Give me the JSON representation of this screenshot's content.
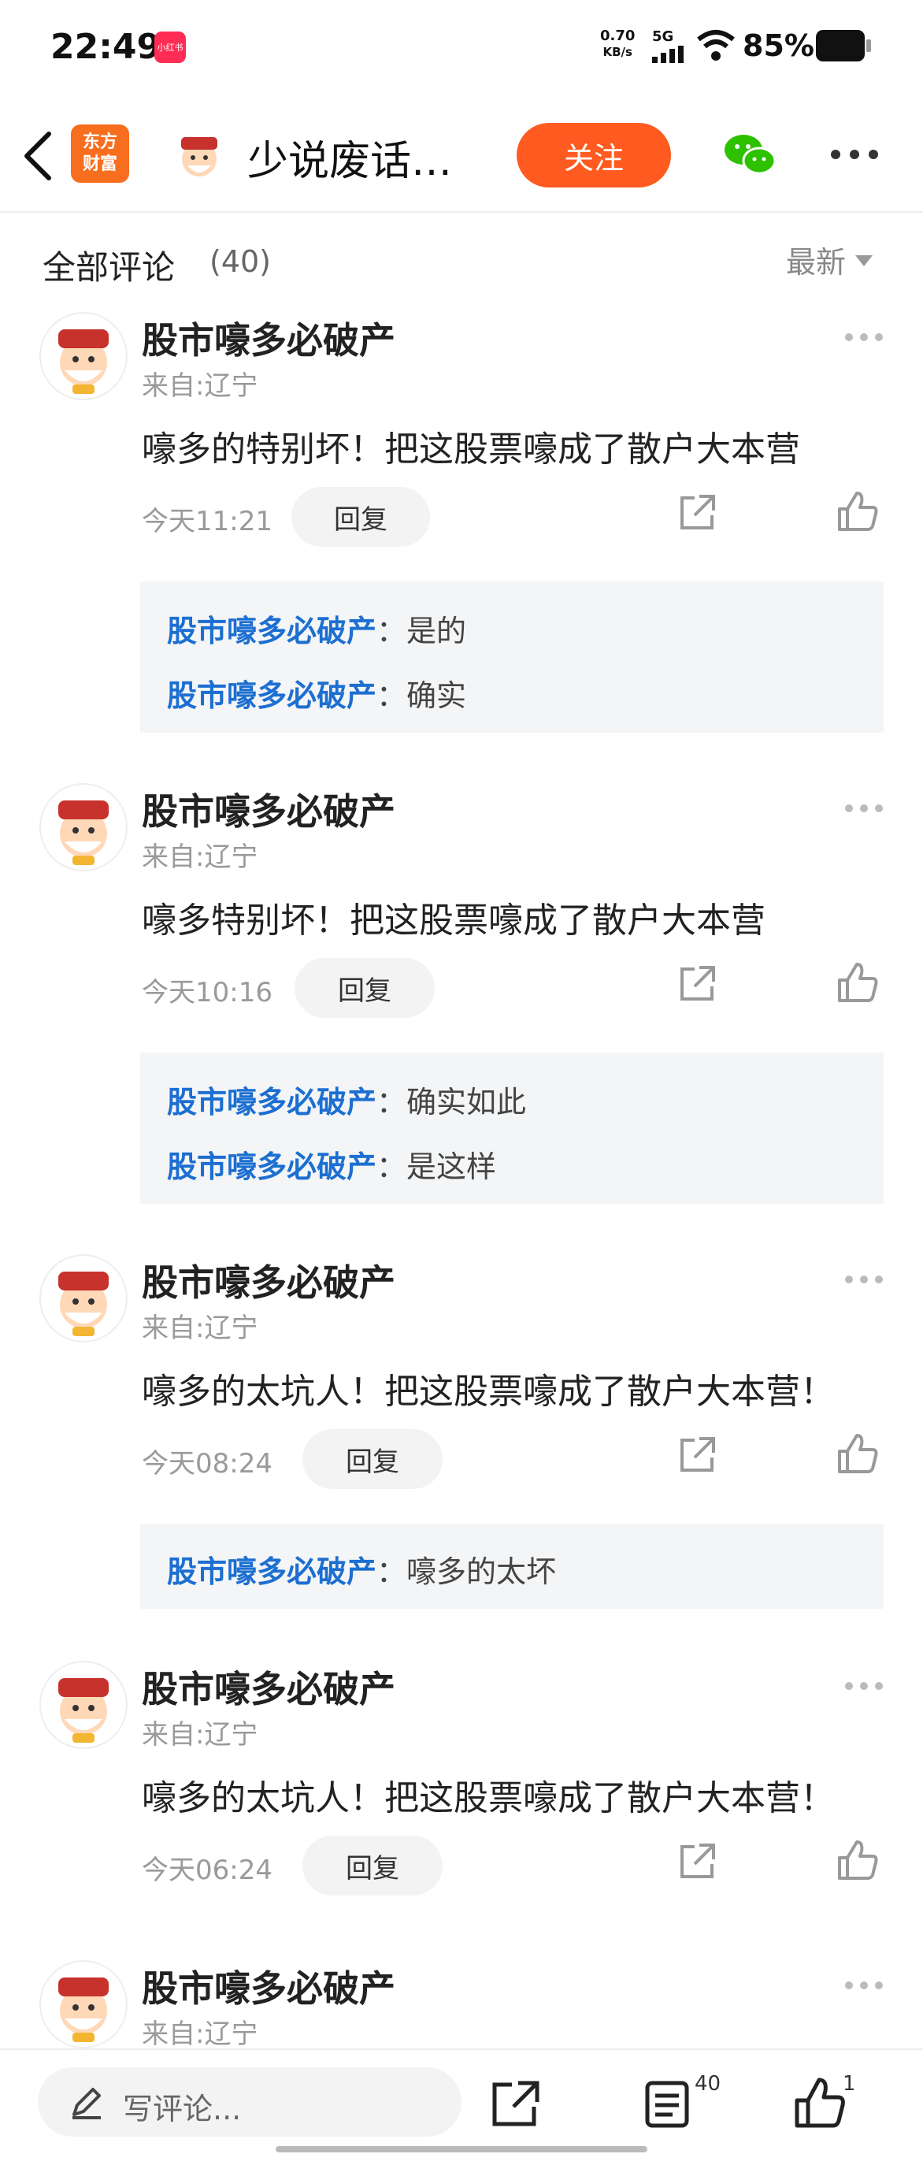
{
  "status_bar": {
    "time": "22:49",
    "app_badge": "小红书",
    "net_speed_value": "0.70",
    "net_speed_unit": "KB/s",
    "network": "5G",
    "battery": "85%"
  },
  "header": {
    "logo_line1": "东方",
    "logo_line2": "财富",
    "title": "少说废话…",
    "follow_label": "关注"
  },
  "section": {
    "title": "全部评论",
    "count": "(40)",
    "sort_label": "最新"
  },
  "comments": [
    {
      "user": "股市嚎多必破产",
      "location": "来自:辽宁",
      "text": "嚎多的特别坏！把这股票嚎成了散户大本营",
      "time": "今天11:21",
      "reply_label": "回复",
      "replies": [
        {
          "user": "股市嚎多必破产",
          "text": "：是的"
        },
        {
          "user": "股市嚎多必破产",
          "text": "：确实"
        }
      ]
    },
    {
      "user": "股市嚎多必破产",
      "location": "来自:辽宁",
      "text": "嚎多特别坏！把这股票嚎成了散户大本营",
      "time": "今天10:16",
      "reply_label": "回复",
      "replies": [
        {
          "user": "股市嚎多必破产",
          "text": "：确实如此"
        },
        {
          "user": "股市嚎多必破产",
          "text": "：是这样"
        }
      ]
    },
    {
      "user": "股市嚎多必破产",
      "location": "来自:辽宁",
      "text": "嚎多的太坑人！把这股票嚎成了散户大本营！",
      "time": "今天08:24",
      "reply_label": "回复",
      "replies": [
        {
          "user": "股市嚎多必破产",
          "text": "：嚎多的太坏"
        }
      ]
    },
    {
      "user": "股市嚎多必破产",
      "location": "来自:辽宁",
      "text": "嚎多的太坑人！把这股票嚎成了散户大本营！",
      "time": "今天06:24",
      "reply_label": "回复",
      "replies": []
    },
    {
      "user": "股市嚎多必破产",
      "location": "来自:辽宁"
    }
  ],
  "bottom_bar": {
    "input_placeholder": "写评论...",
    "comments_badge": "40",
    "likes_badge": "1"
  },
  "colors": {
    "accent": "#ff5a1f",
    "link": "#1c6fd1",
    "wechat": "#2dc100"
  }
}
